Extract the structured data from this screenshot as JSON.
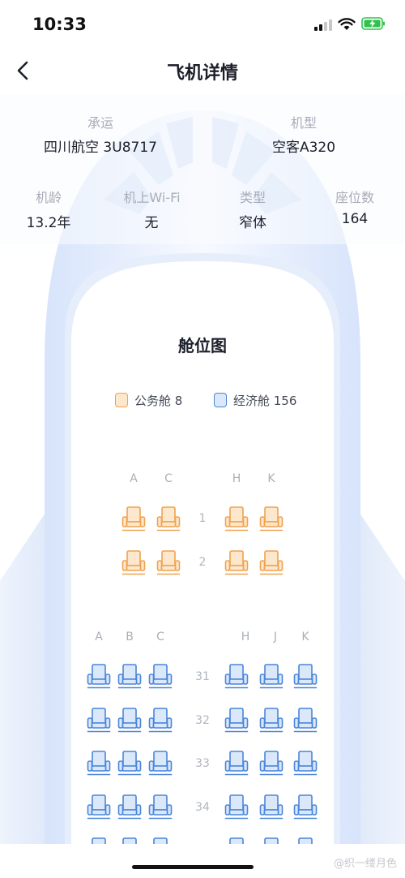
{
  "status_bar": {
    "time": "10:33"
  },
  "header": {
    "title": "飞机详情",
    "back_icon": "chevron-left-icon"
  },
  "info": {
    "carrier_label": "承运",
    "carrier_value": "四川航空 3U8717",
    "model_label": "机型",
    "model_value": "空客A320",
    "age_label": "机龄",
    "age_value": "13.2年",
    "wifi_label": "机上Wi-Fi",
    "wifi_value": "无",
    "type_label": "类型",
    "type_value": "窄体",
    "seats_label": "座位数",
    "seats_value": "164"
  },
  "cabin": {
    "title": "舱位图",
    "legend": {
      "business": "公务舱 8",
      "economy": "经济舱 156"
    },
    "business": {
      "columns": [
        "A",
        "C",
        "H",
        "K"
      ],
      "rows": [
        "1",
        "2"
      ]
    },
    "economy": {
      "columns": [
        "A",
        "B",
        "C",
        "H",
        "J",
        "K"
      ],
      "rows": [
        "31",
        "32",
        "33",
        "34"
      ]
    }
  },
  "watermark": "@织一缕月色",
  "colors": {
    "business": "#f0a24f",
    "business_fill": "#fde7cd",
    "economy": "#4a86d9",
    "economy_fill": "#dbe8fa",
    "plane_body": "#dce8fb"
  }
}
